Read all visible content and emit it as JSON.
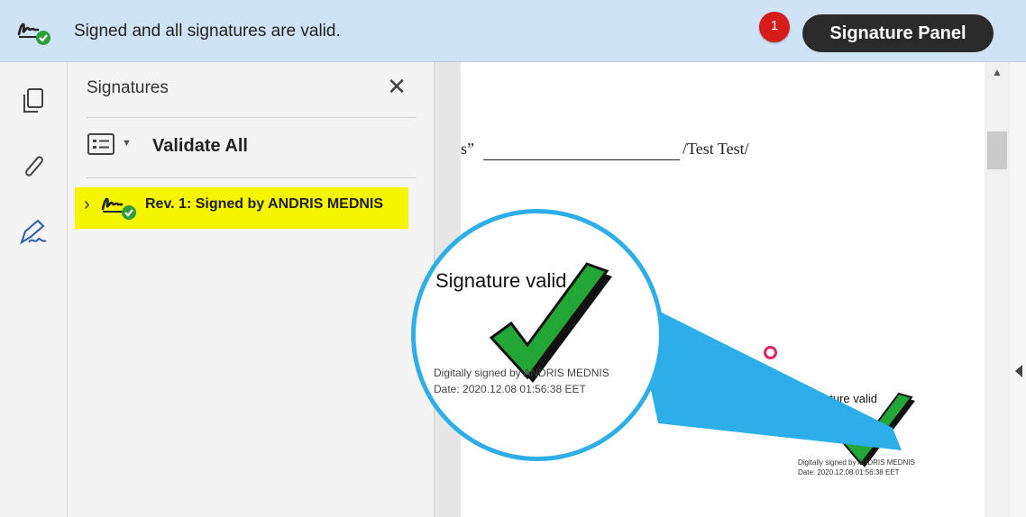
{
  "topbar": {
    "message": "Signed and all signatures are valid.",
    "badge_count": "1",
    "panel_button": "Signature Panel",
    "icon": "signature-valid-icon"
  },
  "rail": {
    "tools": [
      "copy-pages-icon",
      "paperclip-icon",
      "signature-pen-icon"
    ]
  },
  "panel": {
    "title": "Signatures",
    "close_icon": "close-icon",
    "options_icon": "list-options-icon",
    "validate_all": "Validate All",
    "revision_label": "Rev. 1: Signed by ANDRIS MEDNIS",
    "highlight_color": "#f5f500"
  },
  "document": {
    "line_prefix": "s”",
    "line_suffix": "/Test Test/",
    "signature": {
      "status": "Signature valid",
      "signed_by": "Digitally signed by ANDRIS MEDNIS",
      "date": "Date: 2020.12.08 01:56:38 EET"
    }
  },
  "colors": {
    "topbar_bg": "#cfe3f6",
    "badge": "#d61b1b",
    "magnifier_border": "#2eaee8",
    "check_green": "#22a737"
  }
}
